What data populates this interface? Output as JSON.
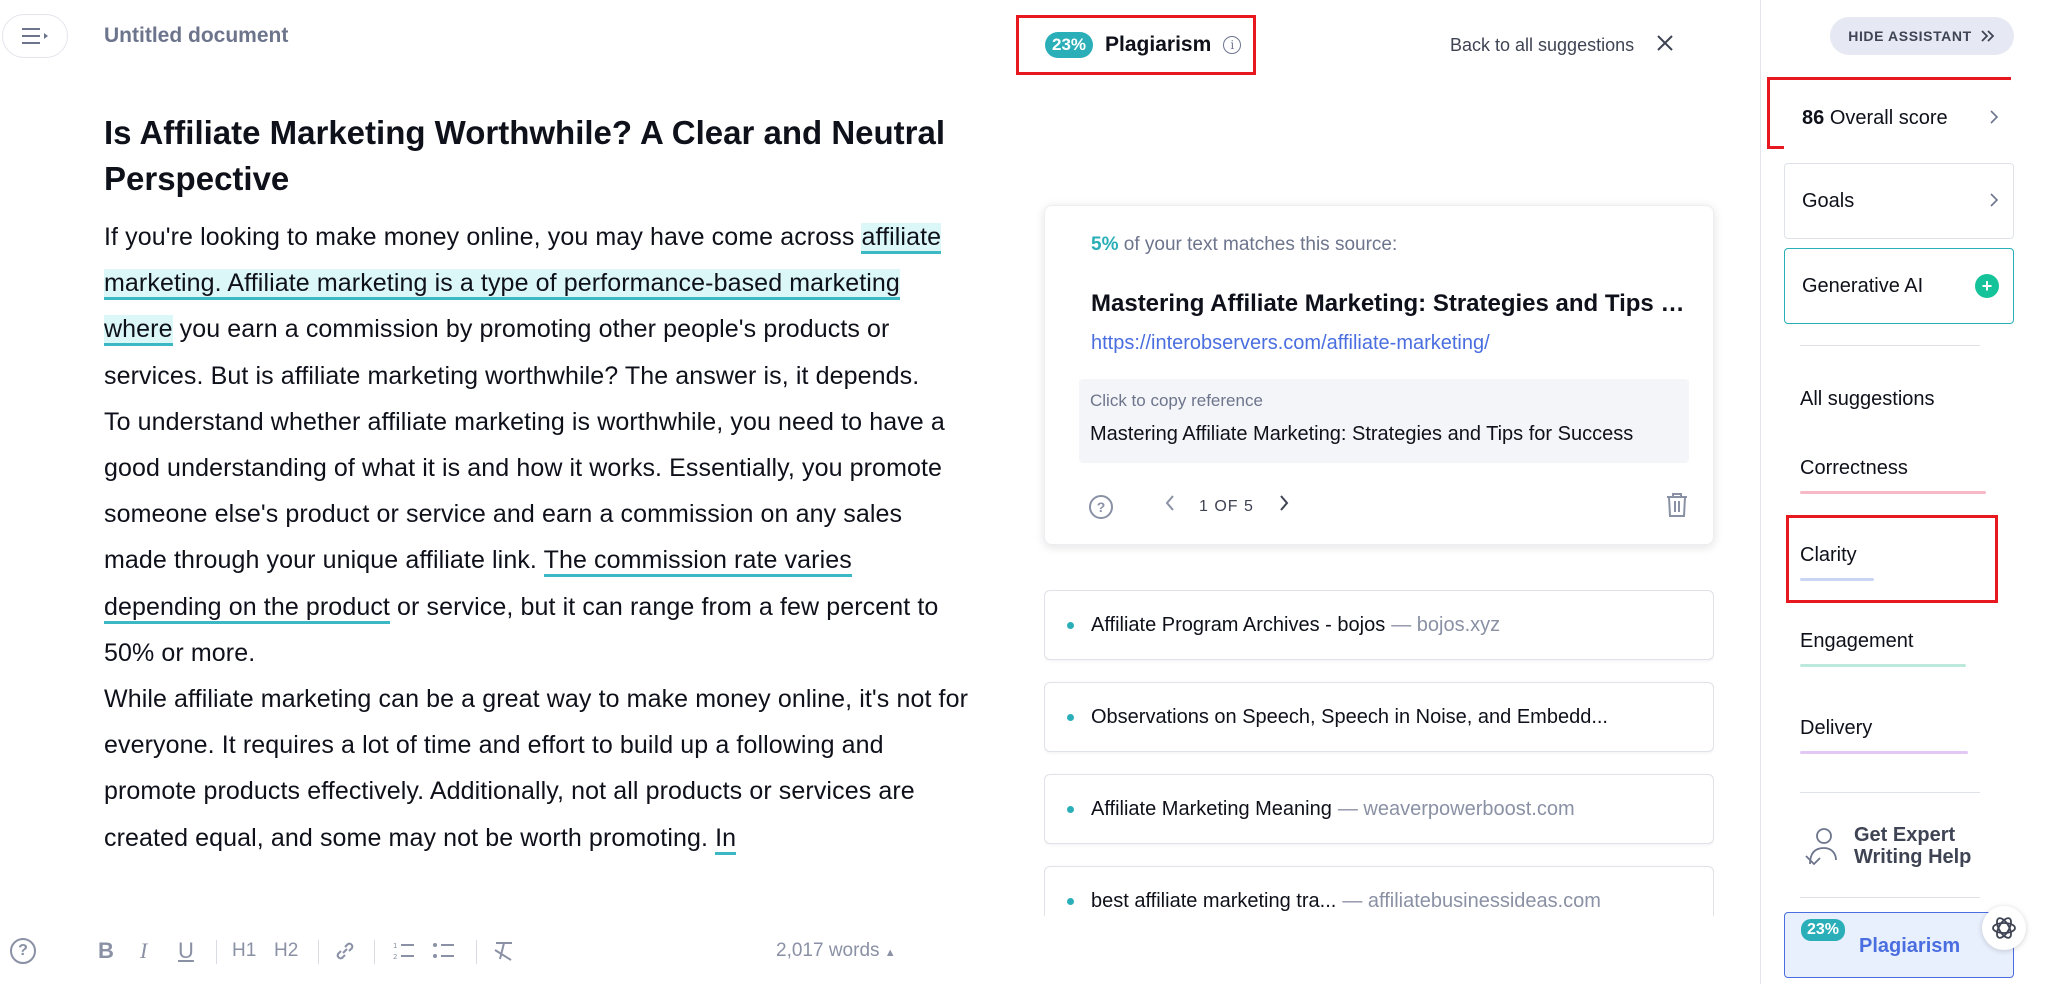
{
  "document": {
    "title": "Untitled document",
    "heading": "Is Affiliate Marketing Worthwhile? A Clear and Neutral Perspective",
    "p1_a": "If you're looking to make money online, you may have come across ",
    "p1_hl": "affiliate marketing. Affiliate marketing is a type of performance-based marketing where",
    "p1_b": " you earn a commission by promoting other people's products or services. But is affiliate marketing worthwhile? The answer is, it depends.",
    "p2_a": "To understand whether affiliate marketing is worthwhile, you need to have a good understanding of what it is and how it works. Essentially, you promote someone else's product or service and earn a commission on any sales made through your unique affiliate link. ",
    "p2_ul": "The commission rate varies depending on the product",
    "p2_b": " or service, but it can range from a few percent to 50% or more.",
    "p3_a": "While affiliate marketing can be a great way to make money online, it's not for everyone. It requires a lot of time and effort to build up a following and promote products effectively. Additionally, not all products or services are created equal, and some may not be worth promoting. ",
    "p3_ul": "In",
    "word_count": "2,017 words"
  },
  "toolbar": {
    "help": "?",
    "bold": "B",
    "italic": "I",
    "underline": "U",
    "h1": "H1",
    "h2": "H2"
  },
  "plagiarism": {
    "percent": "23%",
    "title": "Plagiarism",
    "back_label": "Back to all suggestions",
    "match_percent": "5%",
    "match_text": " of your text matches this source:",
    "source_title": "Mastering Affiliate Marketing: Strategies and Tips for Success",
    "source_url": "https://interobservers.com/affiliate-marketing/",
    "copy_label": "Click to copy reference",
    "reference_text": "Mastering Affiliate Marketing: Strategies and Tips for Success",
    "pager": "1 OF 5",
    "sources": [
      {
        "title": "Affiliate Program Archives - bojos",
        "domain": "— bojos.xyz"
      },
      {
        "title": "Observations on Speech, Speech in Noise, and Embedd...",
        "domain": ""
      },
      {
        "title": "Affiliate Marketing Meaning",
        "domain": "— weaverpowerboost.com"
      },
      {
        "title": "best affiliate marketing tra...",
        "domain": "— affiliatebusinessideas.com"
      }
    ]
  },
  "sidebar": {
    "hide_label": "HIDE ASSISTANT",
    "score": "86",
    "score_label": "Overall score",
    "goals_label": "Goals",
    "gen_ai_label": "Generative AI",
    "nav": [
      "All suggestions",
      "Correctness",
      "Clarity",
      "Engagement",
      "Delivery"
    ],
    "expert_line1": "Get Expert",
    "expert_line2": "Writing Help",
    "plag_percent": "23%",
    "plag_label": "Plagiarism"
  },
  "colors": {
    "accent_teal": "#2aaeb8",
    "link_blue": "#4a6ee0",
    "annotation_red": "#e8191e",
    "correctness": "#f7b9c6",
    "clarity": "#c8d6f4",
    "engagement": "#bde9dc",
    "delivery": "#e2c9f5"
  }
}
